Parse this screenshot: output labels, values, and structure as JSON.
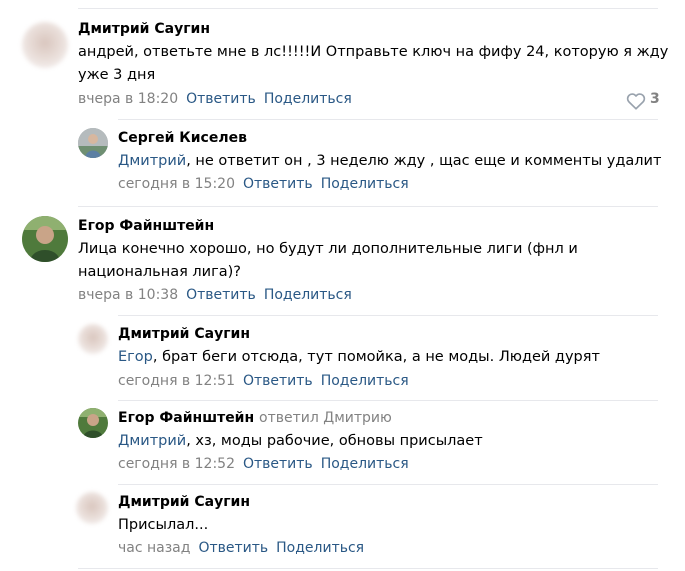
{
  "comments": [
    {
      "author": "Дмитрий Саугин",
      "line1": "андрей, ответьте мне в лс!!!!!И Отправьте ключ на фифу 24, которую я жду",
      "line2": "уже 3 дня",
      "time": "вчера в 18:20",
      "reply": "Ответить",
      "share": "Поделиться",
      "likes": "3"
    },
    {
      "author": "Сергей Киселев",
      "mention": "Дмитрий",
      "text": ", не ответит он , 3 неделю жду , щас еще и комменты удалит",
      "time": "сегодня в 15:20",
      "reply": "Ответить",
      "share": "Поделиться"
    },
    {
      "author": "Егор Файнштейн",
      "line1": "Лица конечно хорошо, но будут ли дополнительные лиги (фнл и",
      "line2": "национальная лига)?",
      "time": "вчера в 10:38",
      "reply": "Ответить",
      "share": "Поделиться"
    },
    {
      "author": "Дмитрий Саугин",
      "mention": "Егор",
      "text": ", брат беги отсюда, тут помойка, а не моды. Людей дурят",
      "time": "сегодня в 12:51",
      "reply": "Ответить",
      "share": "Поделиться"
    },
    {
      "author": "Егор Файнштейн",
      "replied_to": "ответил Дмитрию",
      "mention": "Дмитрий",
      "text": ", хз, моды рабочие, обновы присылает",
      "time": "сегодня в 12:52",
      "reply": "Ответить",
      "share": "Поделиться"
    },
    {
      "author": "Дмитрий Саугин",
      "text": "Присылал...",
      "time": "час назад",
      "reply": "Ответить",
      "share": "Поделиться"
    }
  ]
}
